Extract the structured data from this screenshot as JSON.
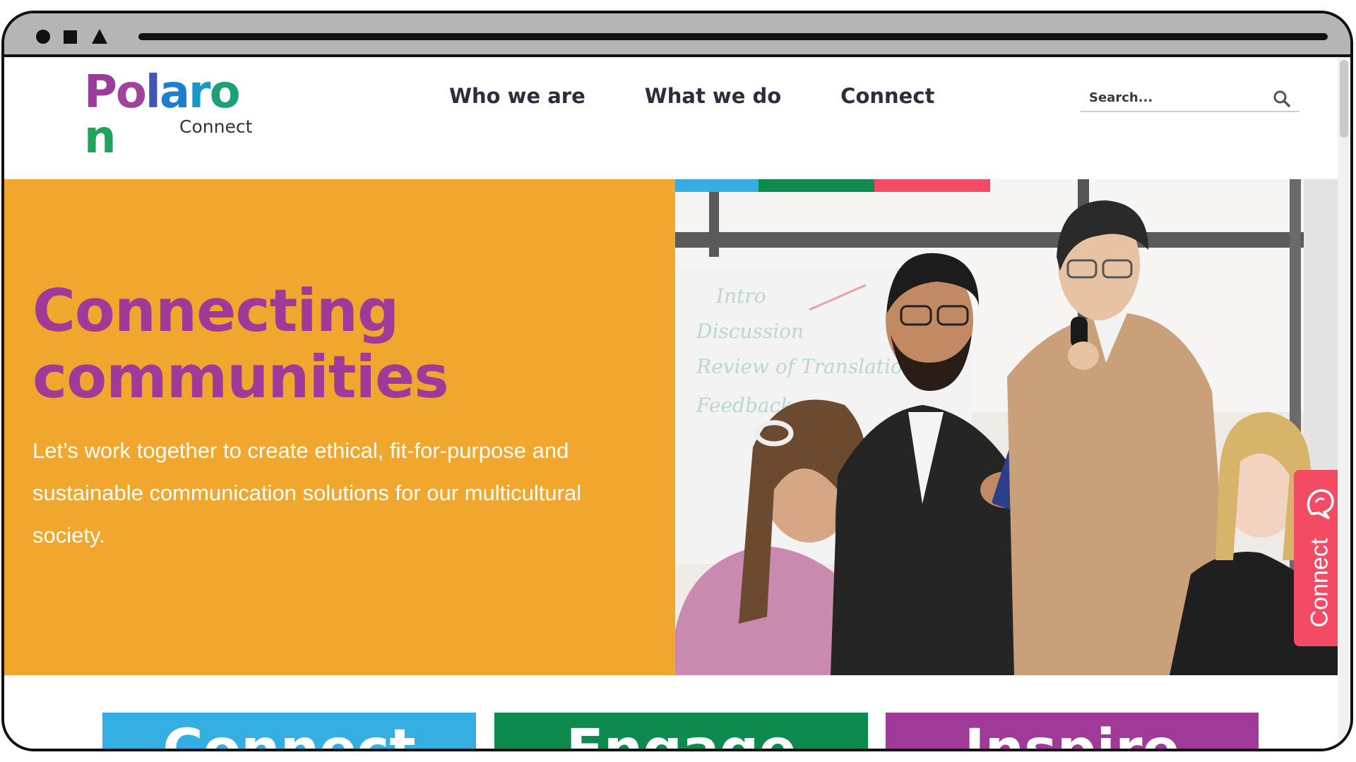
{
  "brand": {
    "logo_letters": [
      "P",
      "o",
      "l",
      "a",
      "r",
      "o",
      "n"
    ],
    "logo_letter_colors": [
      "#9b3b9e",
      "#a0439c",
      "#3f59b2",
      "#1f7fcf",
      "#1a98c8",
      "#1aa276",
      "#21a35a"
    ],
    "logo_sub": "Connect"
  },
  "nav": {
    "items": [
      {
        "label": "Who we are"
      },
      {
        "label": "What we do"
      },
      {
        "label": "Connect"
      }
    ]
  },
  "search": {
    "placeholder": "Search...",
    "value": "",
    "icon": "search-icon"
  },
  "hero": {
    "title_line1": "Connecting",
    "title_line2": "communities",
    "text": "Let’s work together to create ethical, fit-for-purpose and sustainable communication solutions for our multicultural society.",
    "background_color": "#f1a72e",
    "title_color": "#a03a98",
    "accent_bar_colors": [
      "#35aee2",
      "#0e8a4e",
      "#f24b63"
    ],
    "photo_whiteboard_lines": [
      "Intro",
      "Discussion",
      "Review of Translation",
      "Feedback"
    ]
  },
  "floating_tab": {
    "label": "Connect",
    "icon": "chat-bubble-icon",
    "color": "#f24b63"
  },
  "cards": [
    {
      "label": "Connect",
      "color": "#35aee2"
    },
    {
      "label": "Engage",
      "color": "#0e8a4e"
    },
    {
      "label": "Inspire",
      "color": "#a03a98"
    }
  ]
}
